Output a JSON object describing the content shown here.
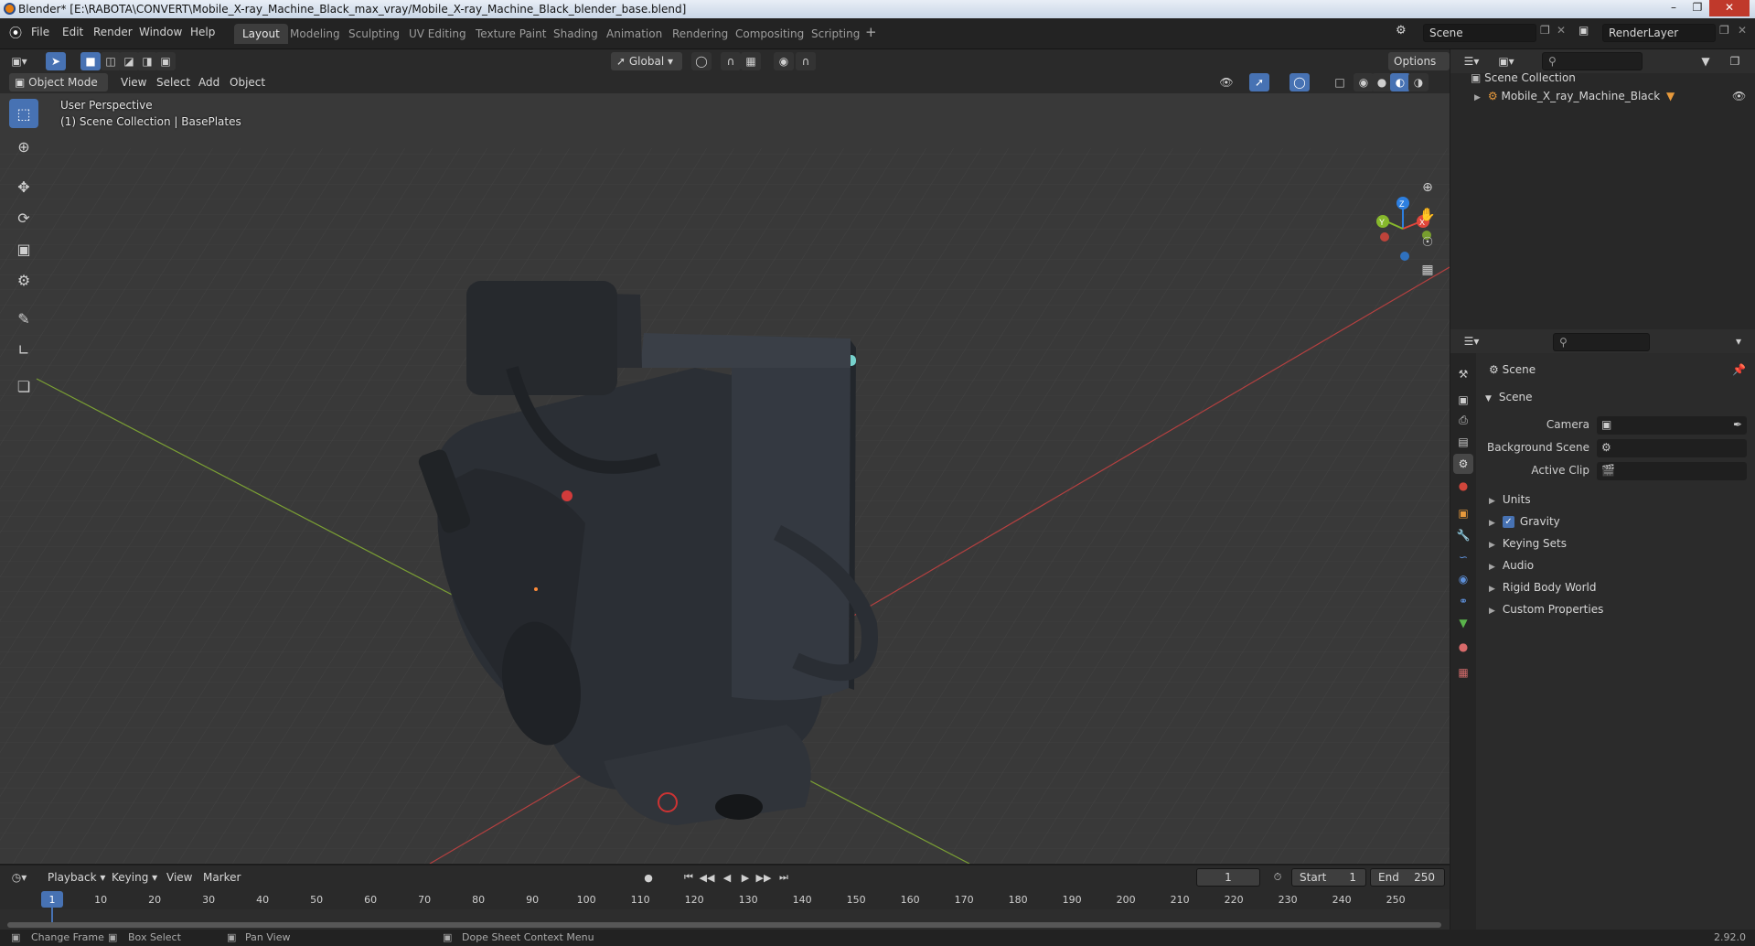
{
  "window": {
    "title": "Blender* [E:\\RABOTA\\CONVERT\\Mobile_X-ray_Machine_Black_max_vray/Mobile_X-ray_Machine_Black_blender_base.blend]"
  },
  "menu": [
    "File",
    "Edit",
    "Render",
    "Window",
    "Help"
  ],
  "workspaces": [
    "Layout",
    "Modeling",
    "Sculpting",
    "UV Editing",
    "Texture Paint",
    "Shading",
    "Animation",
    "Rendering",
    "Compositing",
    "Scripting"
  ],
  "active_workspace": "Layout",
  "scene_field": "Scene",
  "renderlayer_field": "RenderLayer",
  "viewport_header": {
    "transform_orientation": "Global",
    "options_label": "Options",
    "mode": "Object Mode",
    "menus": [
      "View",
      "Select",
      "Add",
      "Object"
    ]
  },
  "viewport": {
    "perspective_label": "User Perspective",
    "collection_label": "(1) Scene Collection | BasePlates",
    "gizmo_axes": [
      "X",
      "Y",
      "Z"
    ]
  },
  "outliner": {
    "root": "Scene Collection",
    "items": [
      {
        "label": "Mobile_X_ray_Machine_Black"
      }
    ]
  },
  "properties": {
    "context_title": "Scene",
    "panel_title": "Scene",
    "fields": [
      {
        "label": "Camera",
        "value": ""
      },
      {
        "label": "Background Scene",
        "value": ""
      },
      {
        "label": "Active Clip",
        "value": ""
      }
    ],
    "subpanels": [
      {
        "label": "Units",
        "checkbox": false
      },
      {
        "label": "Gravity",
        "checkbox": true
      },
      {
        "label": "Keying Sets",
        "checkbox": false
      },
      {
        "label": "Audio",
        "checkbox": false
      },
      {
        "label": "Rigid Body World",
        "checkbox": false
      },
      {
        "label": "Custom Properties",
        "checkbox": false
      }
    ]
  },
  "timeline": {
    "menus": [
      "Playback",
      "Keying",
      "View",
      "Marker"
    ],
    "current_frame": "1",
    "start_label": "Start",
    "start": "1",
    "end_label": "End",
    "end": "250",
    "ticks": [
      "1",
      "10",
      "20",
      "30",
      "40",
      "50",
      "60",
      "70",
      "80",
      "90",
      "100",
      "110",
      "120",
      "130",
      "140",
      "150",
      "160",
      "170",
      "180",
      "190",
      "200",
      "210",
      "220",
      "230",
      "240",
      "250"
    ]
  },
  "statusbar": {
    "items": [
      "Change Frame",
      "Box Select",
      "Pan View",
      "Dope Sheet Context Menu"
    ],
    "version": "2.92.0"
  },
  "colors": {
    "accent": "#4772b3",
    "axis_x": "#e0463b",
    "axis_y": "#87b82c",
    "axis_z": "#2d7fe0"
  }
}
